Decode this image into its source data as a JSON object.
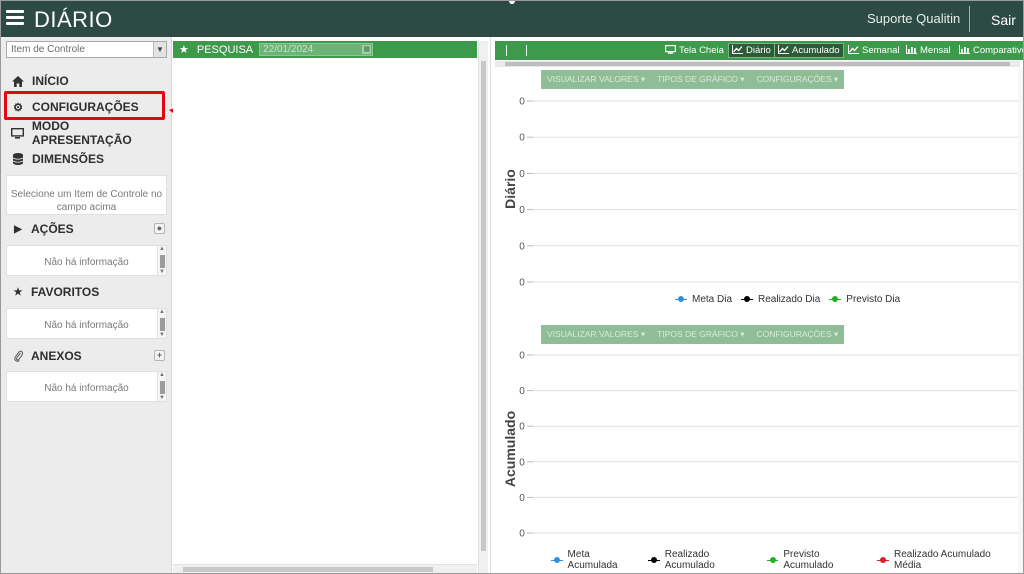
{
  "header": {
    "title": "DIÁRIO",
    "user": "Suporte Qualitin",
    "logout_label": "Sair"
  },
  "sidebar": {
    "select_placeholder": "Item de Controle",
    "nav": [
      {
        "label": "INÍCIO",
        "icon": "home-icon"
      },
      {
        "label": "CONFIGURAÇÕES",
        "icon": "gear-icon"
      },
      {
        "label": "MODO APRESENTAÇÃO",
        "icon": "monitor-icon"
      },
      {
        "label": "DIMENSÕES",
        "icon": "database-icon"
      }
    ],
    "dimensions_message": "Selecione um Item de Controle no campo acima",
    "sections": [
      {
        "label": "AÇÕES",
        "icon": "play-icon",
        "empty": "Não há informação"
      },
      {
        "label": "FAVORITOS",
        "icon": "star-icon",
        "empty": "Não há informação"
      },
      {
        "label": "ANEXOS",
        "icon": "paperclip-icon",
        "empty": "Não há informação"
      }
    ]
  },
  "search": {
    "label": "PESQUISA",
    "date": "22/01/2024"
  },
  "toolbar": {
    "buttons": [
      {
        "label": "Tela Cheia",
        "icon": "monitor-icon",
        "active": false
      },
      {
        "label": "Diário",
        "icon": "line-chart-icon",
        "active": true
      },
      {
        "label": "Acumulado",
        "icon": "line-chart-icon",
        "active": true
      },
      {
        "label": "Semanal",
        "icon": "line-chart-icon",
        "active": false
      },
      {
        "label": "Mensal",
        "icon": "bar-chart-icon",
        "active": false
      },
      {
        "label": "Comparativo",
        "icon": "bar-chart-icon",
        "active": false
      }
    ]
  },
  "chart_menu": {
    "visualizar": "VISUALIZAR VALORES",
    "tipos": "TIPOS DE GRÁFICO",
    "config": "CONFIGURAÇÕES"
  },
  "colors": {
    "header_bg": "#2d4a44",
    "accent_green": "#3d9a4b",
    "highlight_red": "#e30613"
  },
  "chart_data": [
    {
      "type": "line",
      "ylabel": "Diário",
      "y_ticks": [
        0,
        0,
        0,
        0,
        0,
        0
      ],
      "grid": true,
      "legend_position": "bottom",
      "series": [
        {
          "name": "Meta Dia",
          "color": "#2f8fe0",
          "values": []
        },
        {
          "name": "Realizado Dia",
          "color": "#000000",
          "values": []
        },
        {
          "name": "Previsto Dia",
          "color": "#22b022",
          "values": []
        }
      ]
    },
    {
      "type": "line",
      "ylabel": "Acumulado",
      "y_ticks": [
        0,
        0,
        0,
        0,
        0,
        0
      ],
      "grid": true,
      "legend_position": "bottom",
      "series": [
        {
          "name": "Meta Acumulada",
          "color": "#2f8fe0",
          "values": []
        },
        {
          "name": "Realizado Acumulado",
          "color": "#000000",
          "values": []
        },
        {
          "name": "Previsto Acumulado",
          "color": "#22b022",
          "values": []
        },
        {
          "name": "Realizado Acumulado Média",
          "color": "#e02020",
          "values": []
        }
      ]
    }
  ]
}
